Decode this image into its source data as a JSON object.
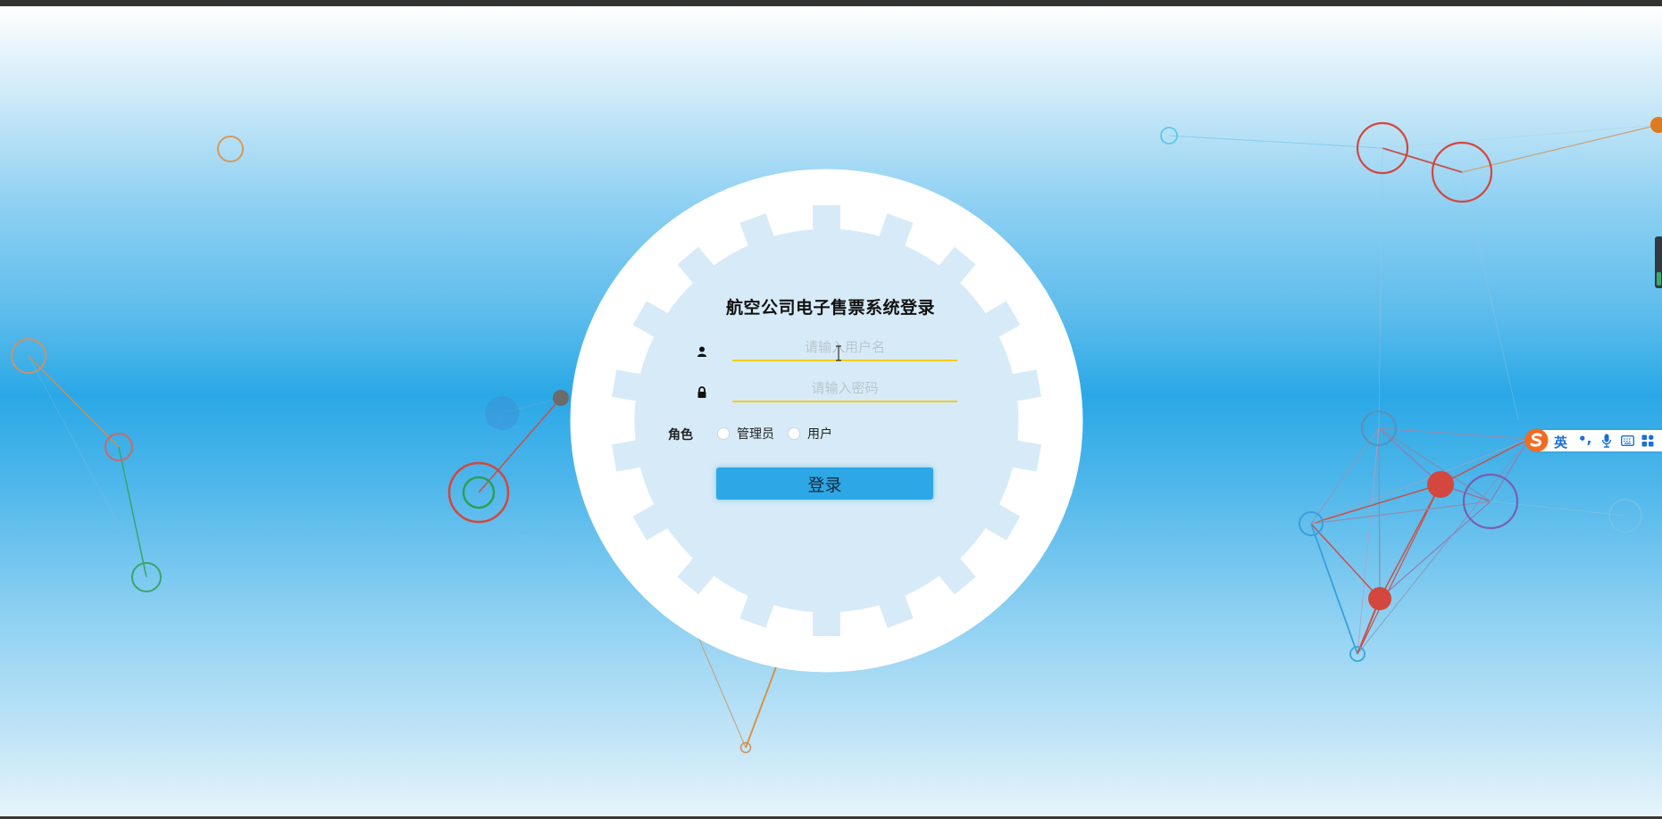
{
  "login": {
    "title": "航空公司电子售票系统登录",
    "username_placeholder": "请输入用户名",
    "password_placeholder": "请输入密码",
    "role_label": "角色",
    "role_options": [
      "管理员",
      "用户"
    ],
    "submit_label": "登录"
  },
  "ime": {
    "language": "英",
    "punctuation": "•,"
  },
  "colors": {
    "accent": "#2ea7e6",
    "underline": "#f3cc1e",
    "form_bg": "#d6ebf7"
  },
  "icons": [
    "user-icon",
    "lock-icon",
    "sogou-logo-icon",
    "microphone-icon",
    "keyboard-icon",
    "toolbox-icon"
  ]
}
